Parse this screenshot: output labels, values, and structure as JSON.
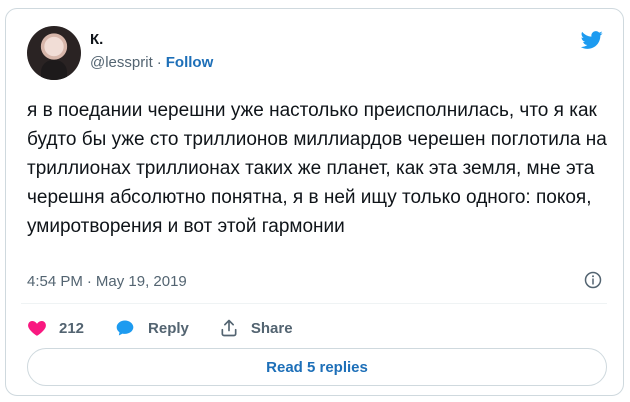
{
  "author": {
    "name": "К.",
    "handle": "@lessprit",
    "separator": "·",
    "follow_label": "Follow"
  },
  "tweet": {
    "text": "я в поедании черешни уже настолько преисполнилась, что я как будто бы уже сто триллионов миллиардов черешен поглотила на триллионах триллионах таких же планет, как эта земля, мне эта черешня абсолютно понятна, я в ней ищу только одного: покоя, умиротворения и вот этой гармонии",
    "time": "4:54 PM",
    "separator": "·",
    "date": "May 19, 2019"
  },
  "actions": {
    "like_count": "212",
    "reply_label": "Reply",
    "share_label": "Share"
  },
  "replies": {
    "label": "Read 5 replies"
  },
  "icons": {
    "brand": "twitter-bird-icon",
    "info": "info-icon",
    "like": "heart-icon",
    "reply": "speech-bubble-icon",
    "share": "share-icon"
  },
  "colors": {
    "brand_blue": "#1d9bf0",
    "link_blue": "#1d6fb8",
    "like_pink": "#f91880",
    "muted_text": "#536471",
    "border": "#cfd9de"
  }
}
